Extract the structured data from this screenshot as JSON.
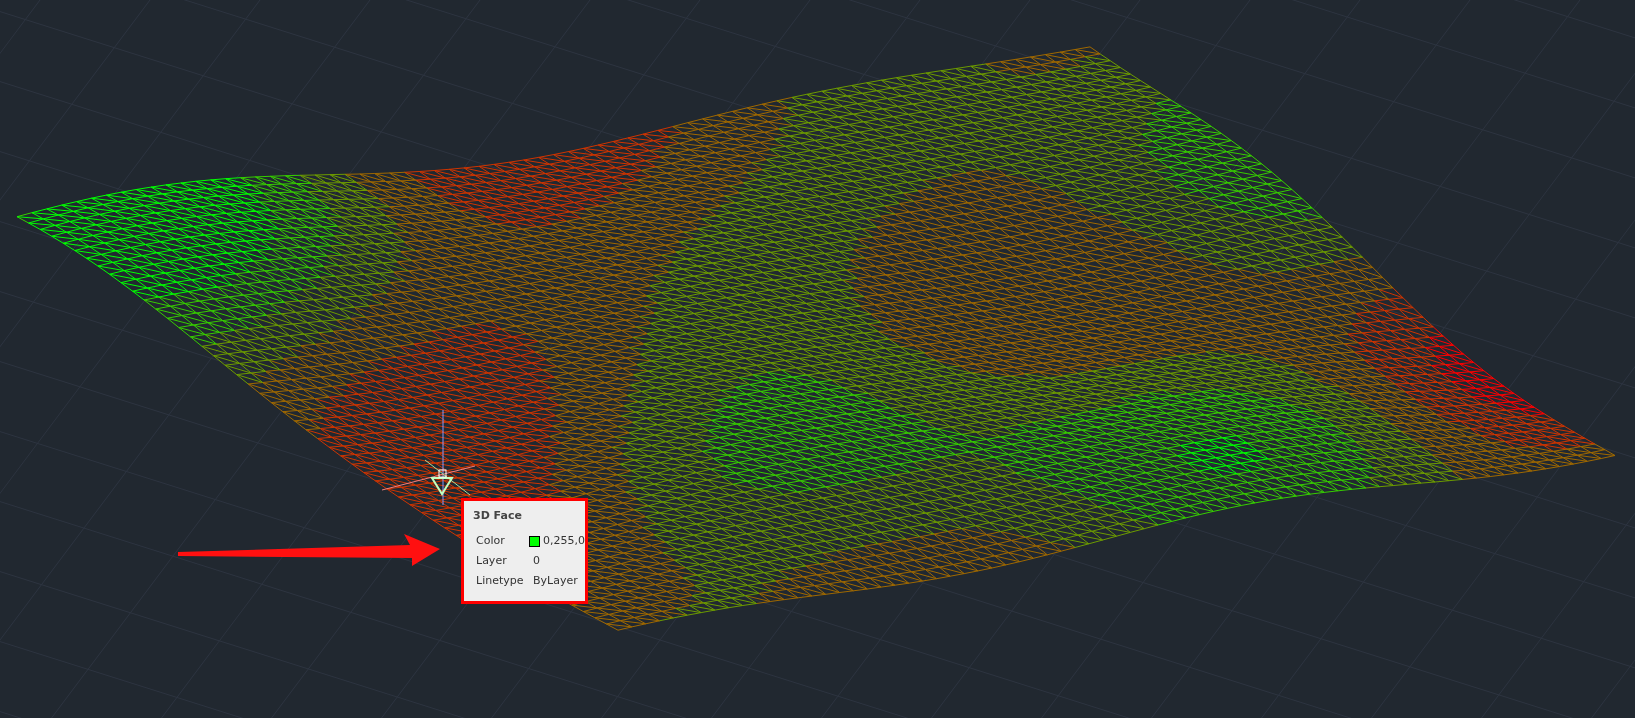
{
  "tooltip": {
    "title": "3D Face",
    "rows": [
      {
        "label": "Color",
        "value": "0,255,0",
        "color": "#00ff00"
      },
      {
        "label": "Layer",
        "value": "0"
      },
      {
        "label": "Linetype",
        "value": "ByLayer"
      }
    ]
  }
}
